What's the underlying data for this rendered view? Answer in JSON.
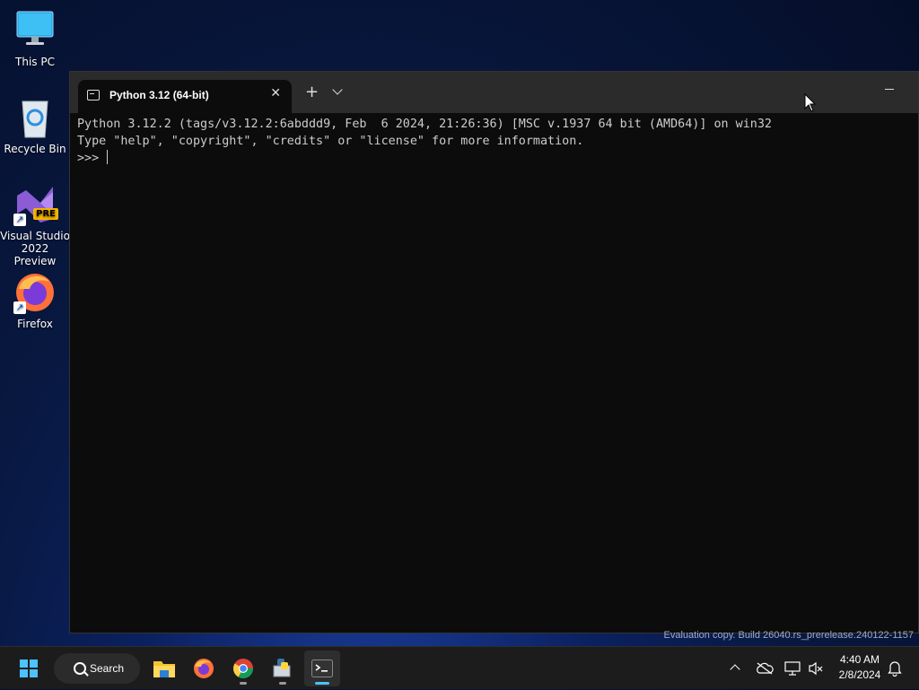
{
  "desktop": {
    "icons": [
      {
        "label": "This PC",
        "icon": "monitor-icon"
      },
      {
        "label": "Recycle Bin",
        "icon": "recycle-bin-icon"
      },
      {
        "label": "Visual Studio 2022 Preview",
        "icon": "visual-studio-icon",
        "badge": "PRE"
      },
      {
        "label": "Firefox",
        "icon": "firefox-icon"
      }
    ]
  },
  "terminal": {
    "tab_title": "Python 3.12 (64-bit)",
    "lines": [
      "Python 3.12.2 (tags/v3.12.2:6abddd9, Feb  6 2024, 21:26:36) [MSC v.1937 64 bit (AMD64)] on win32",
      "Type \"help\", \"copyright\", \"credits\" or \"license\" for more information.",
      ">>> "
    ],
    "colors": {
      "background": "#0c0c0c",
      "titlebar": "#2b2b2b",
      "text": "#cccccc"
    }
  },
  "watermark": "Evaluation copy. Build 26040.rs_prerelease.240122-1157",
  "taskbar": {
    "search_label": "Search",
    "pinned": [
      "start-icon",
      "file-explorer-icon",
      "firefox-icon",
      "chrome-icon",
      "python-installer-icon",
      "terminal-icon"
    ],
    "tray_icons": [
      "chevron-up-icon",
      "onedrive-icon",
      "network-icon",
      "volume-muted-icon",
      "notification-icon"
    ],
    "time": "4:40 AM",
    "date": "2/8/2024",
    "accent": "#4cc2ff"
  }
}
